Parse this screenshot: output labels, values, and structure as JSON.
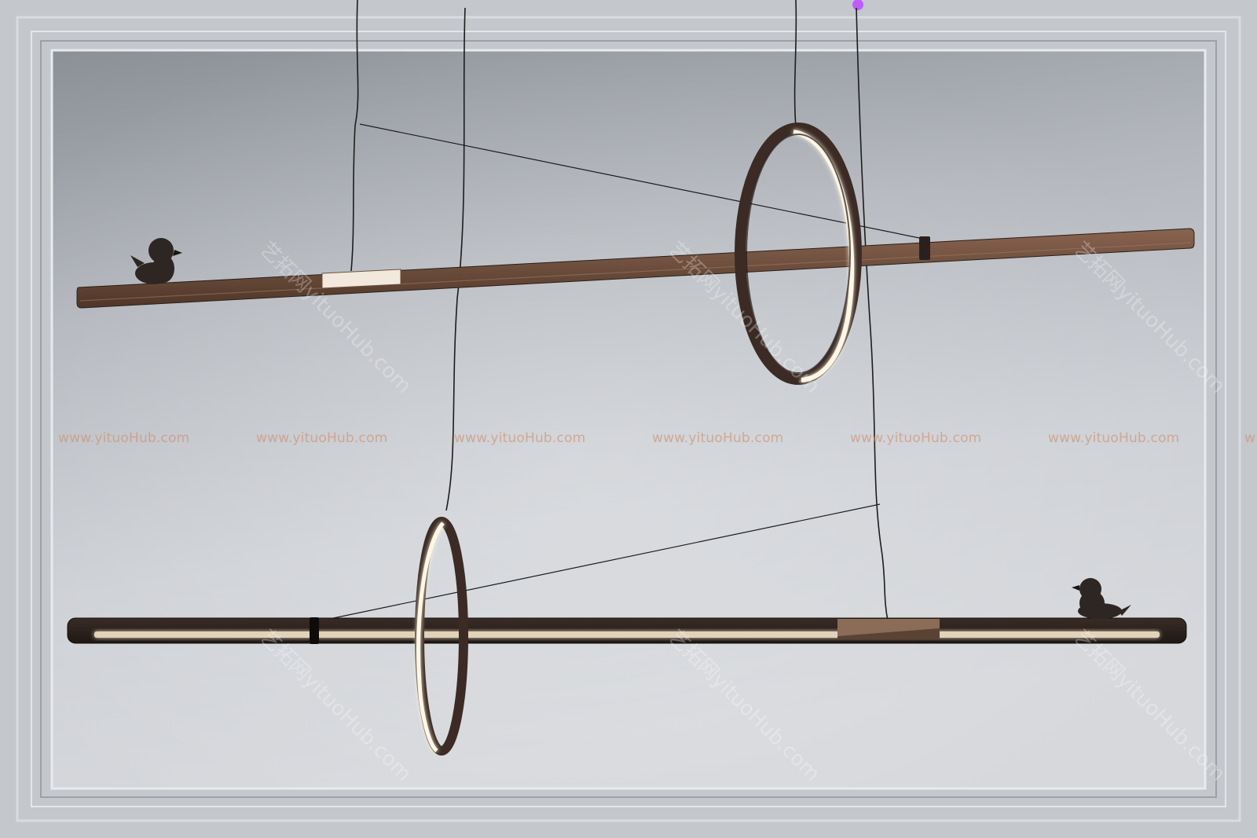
{
  "watermark": {
    "horizontal": [
      "www.yituoHub.com",
      "www.yituoHub.com",
      "www.yituoHub.com",
      "www.yituoHub.com",
      "www.yituoHub.com",
      "www.yituoHub.com",
      "w"
    ],
    "diagonal": [
      "艺拓网yituoHub.com",
      "艺拓网yituoHub.com",
      "艺拓网yituoHub.com",
      "艺拓网yituoHub.com",
      "艺拓网yituoHub.com",
      "艺拓网yituoHub.com"
    ]
  },
  "colors": {
    "wall_light": "#d2d5da",
    "wall_dark": "#8e939a",
    "molding": "#c3c6cb",
    "bronze": "#6a4a38",
    "bronze_dark": "#3a2a22",
    "led_glow": "#fff3dc",
    "bird": "#2e2622",
    "hook": "#c05cff"
  }
}
